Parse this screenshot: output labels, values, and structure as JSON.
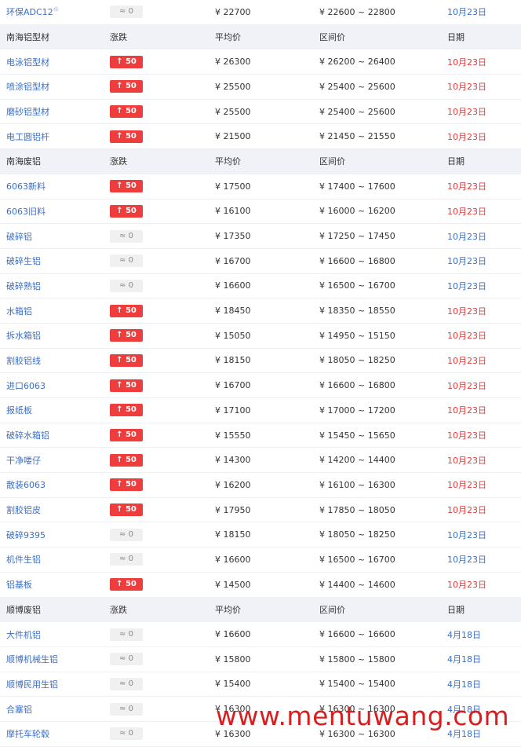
{
  "colors": {
    "up_badge": "#ef3d3d",
    "flat_badge": "#f0f0f0",
    "date_red": "#e23b3b",
    "date_blue": "#3d6fc4",
    "header_bg": "#f1f1f8"
  },
  "rows": [
    {
      "kind": "data",
      "name": "环保ADC12",
      "icon": "recycle-icon",
      "change": "0",
      "direction": "flat",
      "avg": "¥ 22700",
      "range": "¥ 22600 ~ 22800",
      "date": "10月23日",
      "date_color": "blue"
    },
    {
      "kind": "header",
      "name": "南海铝型材",
      "change": "涨跌",
      "avg": "平均价",
      "range": "区间价",
      "date": "日期"
    },
    {
      "kind": "data",
      "name": "电泳铝型材",
      "change": "50",
      "direction": "up",
      "avg": "¥ 26300",
      "range": "¥ 26200 ~ 26400",
      "date": "10月23日",
      "date_color": "red"
    },
    {
      "kind": "data",
      "name": "喷涂铝型材",
      "change": "50",
      "direction": "up",
      "avg": "¥ 25500",
      "range": "¥ 25400 ~ 25600",
      "date": "10月23日",
      "date_color": "red"
    },
    {
      "kind": "data",
      "name": "磨砂铝型材",
      "change": "50",
      "direction": "up",
      "avg": "¥ 25500",
      "range": "¥ 25400 ~ 25600",
      "date": "10月23日",
      "date_color": "red"
    },
    {
      "kind": "data",
      "name": "电工圆铝杆",
      "change": "50",
      "direction": "up",
      "avg": "¥ 21500",
      "range": "¥ 21450 ~ 21550",
      "date": "10月23日",
      "date_color": "red"
    },
    {
      "kind": "header",
      "name": "南海废铝",
      "change": "涨跌",
      "avg": "平均价",
      "range": "区间价",
      "date": "日期"
    },
    {
      "kind": "data",
      "name": "6063新料",
      "change": "50",
      "direction": "up",
      "avg": "¥ 17500",
      "range": "¥ 17400 ~ 17600",
      "date": "10月23日",
      "date_color": "red"
    },
    {
      "kind": "data",
      "name": "6063旧料",
      "change": "50",
      "direction": "up",
      "avg": "¥ 16100",
      "range": "¥ 16000 ~ 16200",
      "date": "10月23日",
      "date_color": "red"
    },
    {
      "kind": "data",
      "name": "破碎铝",
      "change": "0",
      "direction": "flat",
      "avg": "¥ 17350",
      "range": "¥ 17250 ~ 17450",
      "date": "10月23日",
      "date_color": "blue"
    },
    {
      "kind": "data",
      "name": "破碎生铝",
      "change": "0",
      "direction": "flat",
      "avg": "¥ 16700",
      "range": "¥ 16600 ~ 16800",
      "date": "10月23日",
      "date_color": "blue"
    },
    {
      "kind": "data",
      "name": "破碎熟铝",
      "change": "0",
      "direction": "flat",
      "avg": "¥ 16600",
      "range": "¥ 16500 ~ 16700",
      "date": "10月23日",
      "date_color": "blue"
    },
    {
      "kind": "data",
      "name": "水箱铝",
      "change": "50",
      "direction": "up",
      "avg": "¥ 18450",
      "range": "¥ 18350 ~ 18550",
      "date": "10月23日",
      "date_color": "red"
    },
    {
      "kind": "data",
      "name": "拆水箱铝",
      "change": "50",
      "direction": "up",
      "avg": "¥ 15050",
      "range": "¥ 14950 ~ 15150",
      "date": "10月23日",
      "date_color": "red"
    },
    {
      "kind": "data",
      "name": "割胶铝线",
      "change": "50",
      "direction": "up",
      "avg": "¥ 18150",
      "range": "¥ 18050 ~ 18250",
      "date": "10月23日",
      "date_color": "red"
    },
    {
      "kind": "data",
      "name": "进口6063",
      "change": "50",
      "direction": "up",
      "avg": "¥ 16700",
      "range": "¥ 16600 ~ 16800",
      "date": "10月23日",
      "date_color": "red"
    },
    {
      "kind": "data",
      "name": "报纸板",
      "change": "50",
      "direction": "up",
      "avg": "¥ 17100",
      "range": "¥ 17000 ~ 17200",
      "date": "10月23日",
      "date_color": "red"
    },
    {
      "kind": "data",
      "name": "破碎水箱铝",
      "change": "50",
      "direction": "up",
      "avg": "¥ 15550",
      "range": "¥ 15450 ~ 15650",
      "date": "10月23日",
      "date_color": "red"
    },
    {
      "kind": "data",
      "name": "干净喽仔",
      "change": "50",
      "direction": "up",
      "avg": "¥ 14300",
      "range": "¥ 14200 ~ 14400",
      "date": "10月23日",
      "date_color": "red"
    },
    {
      "kind": "data",
      "name": "散装6063",
      "change": "50",
      "direction": "up",
      "avg": "¥ 16200",
      "range": "¥ 16100 ~ 16300",
      "date": "10月23日",
      "date_color": "red"
    },
    {
      "kind": "data",
      "name": "割胶铝皮",
      "change": "50",
      "direction": "up",
      "avg": "¥ 17950",
      "range": "¥ 17850 ~ 18050",
      "date": "10月23日",
      "date_color": "red"
    },
    {
      "kind": "data",
      "name": "破碎9395",
      "change": "0",
      "direction": "flat",
      "avg": "¥ 18150",
      "range": "¥ 18050 ~ 18250",
      "date": "10月23日",
      "date_color": "blue"
    },
    {
      "kind": "data",
      "name": "机件生铝",
      "change": "0",
      "direction": "flat",
      "avg": "¥ 16600",
      "range": "¥ 16500 ~ 16700",
      "date": "10月23日",
      "date_color": "blue"
    },
    {
      "kind": "data",
      "name": "铝基板",
      "change": "50",
      "direction": "up",
      "avg": "¥ 14500",
      "range": "¥ 14400 ~ 14600",
      "date": "10月23日",
      "date_color": "red"
    },
    {
      "kind": "header",
      "name": "顺博废铝",
      "change": "涨跌",
      "avg": "平均价",
      "range": "区间价",
      "date": "日期"
    },
    {
      "kind": "data",
      "name": "大件机铝",
      "change": "0",
      "direction": "flat",
      "avg": "¥ 16600",
      "range": "¥ 16600 ~ 16600",
      "date": "4月18日",
      "date_color": "blue"
    },
    {
      "kind": "data",
      "name": "顺博机械生铝",
      "change": "0",
      "direction": "flat",
      "avg": "¥ 15800",
      "range": "¥ 15800 ~ 15800",
      "date": "4月18日",
      "date_color": "blue"
    },
    {
      "kind": "data",
      "name": "顺博民用生铝",
      "change": "0",
      "direction": "flat",
      "avg": "¥ 15400",
      "range": "¥ 15400 ~ 15400",
      "date": "4月18日",
      "date_color": "blue"
    },
    {
      "kind": "data",
      "name": "合塞铝",
      "change": "0",
      "direction": "flat",
      "avg": "¥ 16300",
      "range": "¥ 16300 ~ 16300",
      "date": "4月18日",
      "date_color": "blue"
    },
    {
      "kind": "data",
      "name": "摩托车轮毂",
      "change": "0",
      "direction": "flat",
      "avg": "¥ 16300",
      "range": "¥ 16300 ~ 16300",
      "date": "4月18日",
      "date_color": "blue"
    }
  ],
  "watermark": "www.mentuwang.com"
}
